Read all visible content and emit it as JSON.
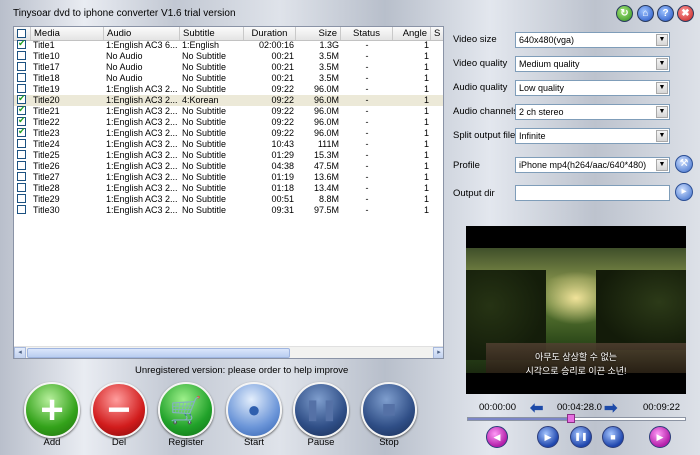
{
  "window": {
    "title": "Tinysoar dvd to iphone converter V1.6 trial version",
    "controls": {
      "refresh": "↻",
      "home": "⌂",
      "help": "?",
      "close": "✖"
    }
  },
  "table": {
    "columns": [
      "Media",
      "Audio",
      "Subtitle",
      "Duration",
      "Size",
      "Status",
      "Angle",
      "S"
    ],
    "rows": [
      {
        "checked": true,
        "media": "Title1",
        "audio": "1:English AC3 6...",
        "subtitle": "1:English",
        "duration": "02:00:16",
        "size": "1.3G",
        "status": "-",
        "angle": "1"
      },
      {
        "checked": false,
        "media": "Title10",
        "audio": "No Audio",
        "subtitle": "No Subtitle",
        "duration": "00:21",
        "size": "3.5M",
        "status": "-",
        "angle": "1"
      },
      {
        "checked": false,
        "media": "Title17",
        "audio": "No Audio",
        "subtitle": "No Subtitle",
        "duration": "00:21",
        "size": "3.5M",
        "status": "-",
        "angle": "1"
      },
      {
        "checked": false,
        "media": "Title18",
        "audio": "No Audio",
        "subtitle": "No Subtitle",
        "duration": "00:21",
        "size": "3.5M",
        "status": "-",
        "angle": "1"
      },
      {
        "checked": false,
        "media": "Title19",
        "audio": "1:English AC3 2...",
        "subtitle": "No Subtitle",
        "duration": "09:22",
        "size": "96.0M",
        "status": "-",
        "angle": "1"
      },
      {
        "checked": true,
        "media": "Title20",
        "audio": "1:English AC3 2...",
        "subtitle": "4:Korean",
        "duration": "09:22",
        "size": "96.0M",
        "status": "-",
        "angle": "1"
      },
      {
        "checked": true,
        "media": "Title21",
        "audio": "1:English AC3 2...",
        "subtitle": "No Subtitle",
        "duration": "09:22",
        "size": "96.0M",
        "status": "-",
        "angle": "1"
      },
      {
        "checked": true,
        "media": "Title22",
        "audio": "1:English AC3 2...",
        "subtitle": "No Subtitle",
        "duration": "09:22",
        "size": "96.0M",
        "status": "-",
        "angle": "1"
      },
      {
        "checked": true,
        "media": "Title23",
        "audio": "1:English AC3 2...",
        "subtitle": "No Subtitle",
        "duration": "09:22",
        "size": "96.0M",
        "status": "-",
        "angle": "1"
      },
      {
        "checked": false,
        "media": "Title24",
        "audio": "1:English AC3 2...",
        "subtitle": "No Subtitle",
        "duration": "10:43",
        "size": "111M",
        "status": "-",
        "angle": "1"
      },
      {
        "checked": false,
        "media": "Title25",
        "audio": "1:English AC3 2...",
        "subtitle": "No Subtitle",
        "duration": "01:29",
        "size": "15.3M",
        "status": "-",
        "angle": "1"
      },
      {
        "checked": false,
        "media": "Title26",
        "audio": "1:English AC3 2...",
        "subtitle": "No Subtitle",
        "duration": "04:38",
        "size": "47.5M",
        "status": "-",
        "angle": "1"
      },
      {
        "checked": false,
        "media": "Title27",
        "audio": "1:English AC3 2...",
        "subtitle": "No Subtitle",
        "duration": "01:19",
        "size": "13.6M",
        "status": "-",
        "angle": "1"
      },
      {
        "checked": false,
        "media": "Title28",
        "audio": "1:English AC3 2...",
        "subtitle": "No Subtitle",
        "duration": "01:18",
        "size": "13.4M",
        "status": "-",
        "angle": "1"
      },
      {
        "checked": false,
        "media": "Title29",
        "audio": "1:English AC3 2...",
        "subtitle": "No Subtitle",
        "duration": "00:51",
        "size": "8.8M",
        "status": "-",
        "angle": "1"
      },
      {
        "checked": false,
        "media": "Title30",
        "audio": "1:English AC3 2...",
        "subtitle": "No Subtitle",
        "duration": "09:31",
        "size": "97.5M",
        "status": "-",
        "angle": "1"
      }
    ],
    "selected_row": "Title20",
    "scroll": {
      "left": "◂",
      "right": "▸"
    }
  },
  "notice": "Unregistered version: please order to help improve",
  "actions": {
    "add": {
      "label": "Add",
      "glyph": "+"
    },
    "del": {
      "label": "Del",
      "glyph": "−"
    },
    "register": {
      "label": "Register",
      "glyph": "🛒"
    },
    "start": {
      "label": "Start",
      "glyph": "●"
    },
    "pause": {
      "label": "Pause",
      "glyph": "❚❚"
    },
    "stop": {
      "label": "Stop",
      "glyph": "■"
    }
  },
  "settings": {
    "video_size": {
      "label": "Video size",
      "value": "640x480(vga)"
    },
    "video_quality": {
      "label": "Video quality",
      "value": "Medium quality"
    },
    "audio_quality": {
      "label": "Audio quality",
      "value": "Low quality"
    },
    "audio_channels": {
      "label": "Audio channels",
      "value": "2 ch stereo"
    },
    "split_output": {
      "label": "Split output file",
      "value": "Infinite"
    },
    "profile": {
      "label": "Profile",
      "value": "iPhone mp4(h264/aac/640*480)"
    },
    "output_dir": {
      "label": "Output dir",
      "value": ""
    },
    "dropdown_arrow": "▼",
    "profile_tool_glyph": "⚒",
    "browse_glyph": "▸"
  },
  "preview": {
    "subtitle_line1": "아무도 상상할 수 없는",
    "subtitle_line2": "시각으로 승리로 이끈 소년!"
  },
  "player": {
    "time_start": "00:00:00",
    "time_current": "00:04:28.0",
    "time_end": "00:09:22",
    "progress": 0.477,
    "back_glyph": "⬅",
    "forward_glyph": "➡",
    "buttons": {
      "prev": "◀",
      "play": "▶",
      "pause": "❚❚",
      "stop": "■",
      "next": "▶"
    }
  },
  "colors": {
    "checkbox_check": "#21a121",
    "selected_row": "#ece9d8",
    "accent": "#1f46ad"
  }
}
